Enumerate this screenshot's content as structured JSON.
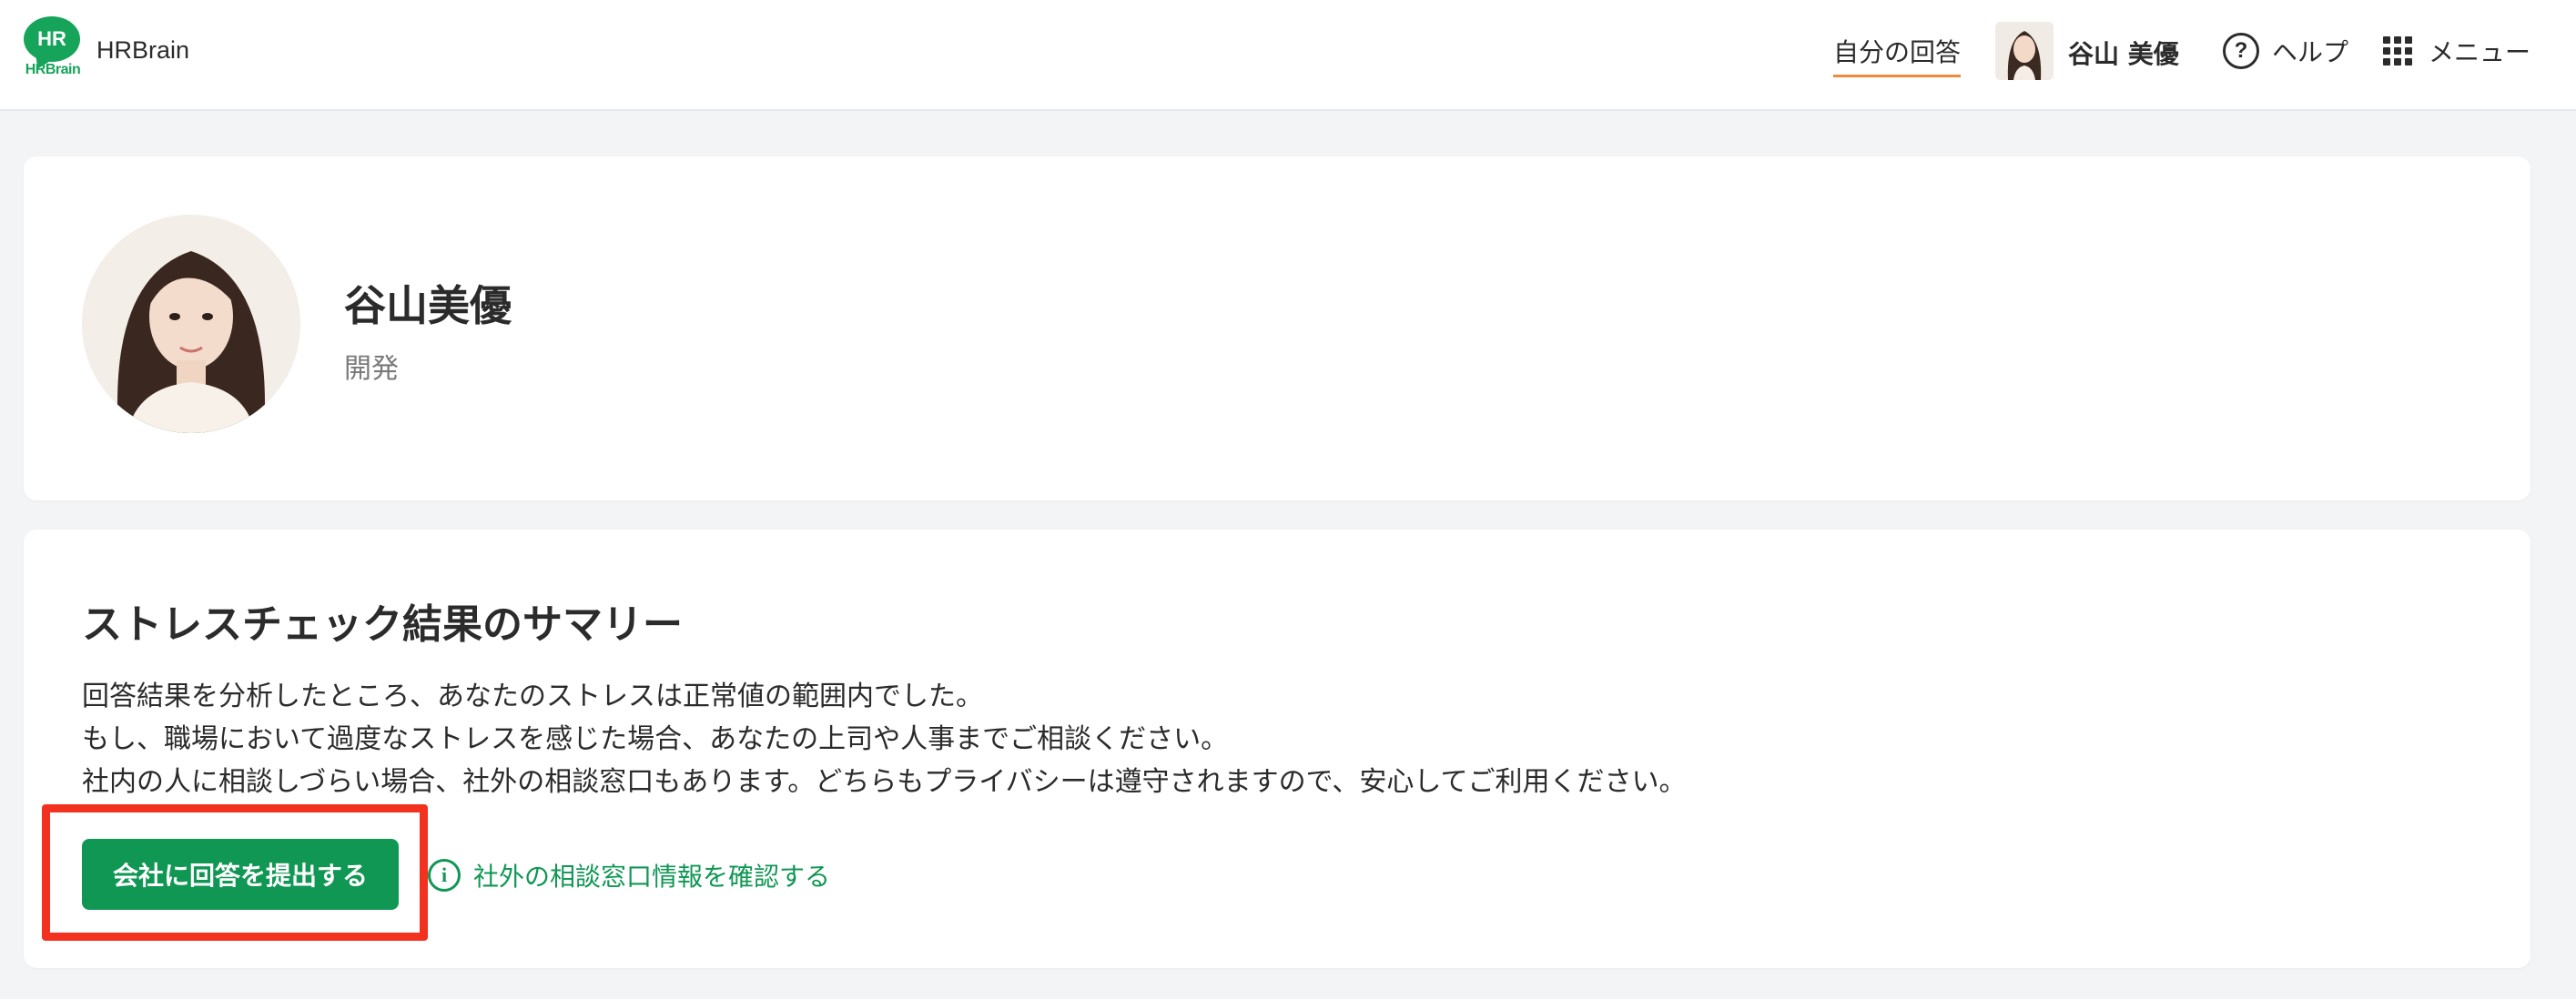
{
  "header": {
    "app_name": "HRBrain",
    "logo_text": "HR",
    "logo_word": "HRBrain",
    "nav_answers": "自分の回答",
    "user_name": "谷山 美優",
    "help_label": "ヘルプ",
    "help_symbol": "?",
    "menu_label": "メニュー"
  },
  "profile": {
    "name": "谷山美優",
    "department": "開発"
  },
  "summary": {
    "title": "ストレスチェック結果のサマリー",
    "lines": [
      "回答結果を分析したところ、あなたのストレスは正常値の範囲内でした。",
      "もし、職場において過度なストレスを感じた場合、あなたの上司や人事までご相談ください。",
      "社内の人に相談しづらい場合、社外の相談窓口もあります。どちらもプライバシーは遵守されますので、安心してご利用ください。"
    ],
    "submit_button": "会社に回答を提出する",
    "info_link": "社外の相談窓口情報を確認する",
    "info_symbol": "i"
  },
  "colors": {
    "brand_green": "#16a45a",
    "button_green": "#109754",
    "nav_underline": "#f08a3a",
    "highlight_red": "#f2311f"
  }
}
